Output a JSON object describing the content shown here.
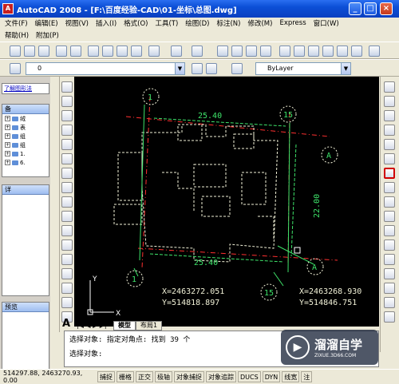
{
  "window": {
    "title": "AutoCAD 2008 - [F:\\百度经验-CAD\\01-坐标\\总图.dwg]"
  },
  "menu": {
    "items": [
      "文件(F)",
      "编辑(E)",
      "视图(V)",
      "插入(I)",
      "格式(O)",
      "工具(T)",
      "绘图(D)",
      "标注(N)",
      "修改(M)",
      "Express",
      "窗口(W)"
    ],
    "items2": [
      "帮助(H)",
      "附加(P)"
    ]
  },
  "layer_combo": {
    "value": "0"
  },
  "bylayer_combo": {
    "value": "ByLayer"
  },
  "left_panel": {
    "link": "了解图形法",
    "tree_title": "备",
    "tree_items": [
      "绒",
      "表",
      "组",
      "组",
      "1.",
      "6."
    ],
    "detail_title": "详",
    "preview_title": "预览"
  },
  "drawing": {
    "dim_top": "25.40",
    "dim_right": "22.00",
    "dim_bottom": "25.40",
    "axis_markers": [
      "1",
      "15",
      "A",
      "1",
      "15",
      "A"
    ],
    "coord1_x": "X=2463272.051",
    "coord1_y": "Y=514818.897",
    "coord2_x": "X=2463268.930",
    "coord2_y": "Y=514846.751",
    "ucs_y": "Y",
    "ucs_x": "X"
  },
  "tabs": [
    "模型",
    "布局1"
  ],
  "command": {
    "line": "选择对象: 指定对角点: 找到 39 个",
    "prompt": "选择对象:"
  },
  "watermark": {
    "brand": "溜溜自学",
    "url": "ZIXUE.3D66.COM"
  },
  "status": {
    "coords": "514297.88, 2463270.93, 0.00",
    "buttons": [
      "捕捉",
      "栅格",
      "正交",
      "极轴",
      "对象捕捉",
      "对象追踪",
      "DUCS",
      "DYN",
      "线宽"
    ],
    "extra": "注"
  }
}
